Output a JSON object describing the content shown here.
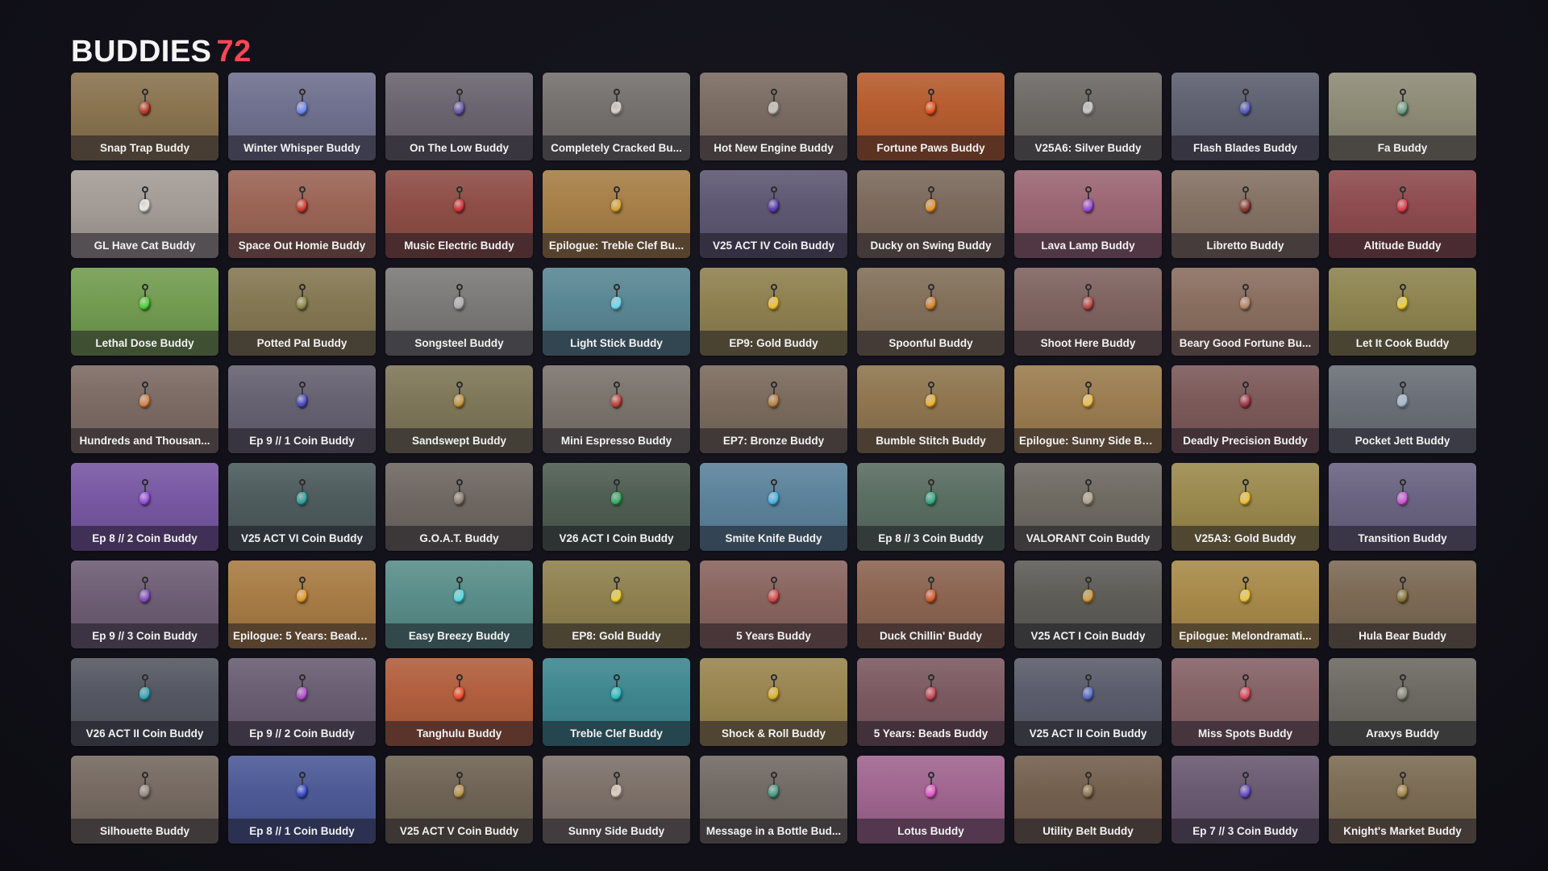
{
  "header": {
    "title": "BUDDIES",
    "count": "72"
  },
  "buddies": [
    {
      "name": "Snap Trap Buddy",
      "bg": "#8a7450",
      "charm": "#c0392b",
      "icon": "snap-trap-charm-icon"
    },
    {
      "name": "Winter Whisper Buddy",
      "bg": "#70718f",
      "charm": "#6e8cf0",
      "icon": "snowflake-charm-icon"
    },
    {
      "name": "On The Low Buddy",
      "bg": "#6a6570",
      "charm": "#6b5bb5",
      "icon": "on-the-low-charm-icon"
    },
    {
      "name": "Completely Cracked Bu...",
      "bg": "#75716e",
      "charm": "#d9d4cc",
      "icon": "cracked-egg-charm-icon"
    },
    {
      "name": "Hot New Engine Buddy",
      "bg": "#7b6c63",
      "charm": "#c8c2b8",
      "icon": "engine-charm-icon"
    },
    {
      "name": "Fortune Paws Buddy",
      "bg": "#b65d30",
      "charm": "#e8541c",
      "icon": "fortune-paws-charm-icon"
    },
    {
      "name": "V25A6: Silver Buddy",
      "bg": "#6d6a66",
      "charm": "#c9c9c9",
      "icon": "silver-emblem-charm-icon"
    },
    {
      "name": "Flash Blades Buddy",
      "bg": "#5f6070",
      "charm": "#5a5fc0",
      "icon": "flash-blades-charm-icon"
    },
    {
      "name": "Fa Buddy",
      "bg": "#8e8b77",
      "charm": "#6aa38c",
      "icon": "fa-charm-icon"
    },
    {
      "name": "GL Have Cat Buddy",
      "bg": "#a39c97",
      "charm": "#ece8e2",
      "icon": "cat-charm-icon"
    },
    {
      "name": "Space Out Homie Buddy",
      "bg": "#9b6556",
      "charm": "#d23a2e",
      "icon": "space-homie-charm-icon"
    },
    {
      "name": "Music Electric Buddy",
      "bg": "#8e4e47",
      "charm": "#d8343a",
      "icon": "guitar-charm-icon"
    },
    {
      "name": "Epilogue: Treble Clef Bu...",
      "bg": "#a77f47",
      "charm": "#d9a637",
      "icon": "treble-clef-charm-icon"
    },
    {
      "name": "V25 ACT IV Coin Buddy",
      "bg": "#5e5873",
      "charm": "#5d3fb8",
      "icon": "coin-charm-icon"
    },
    {
      "name": "Ducky on Swing Buddy",
      "bg": "#7c6a5d",
      "charm": "#f0962a",
      "icon": "duck-charm-icon"
    },
    {
      "name": "Lava Lamp Buddy",
      "bg": "#9c6775",
      "charm": "#9a4fd9",
      "icon": "lava-lamp-charm-icon"
    },
    {
      "name": "Libretto Buddy",
      "bg": "#847264",
      "charm": "#8f3b34",
      "icon": "libretto-charm-icon"
    },
    {
      "name": "Altitude Buddy",
      "bg": "#8e4c4f",
      "charm": "#e04450",
      "icon": "altitude-charm-icon"
    },
    {
      "name": "Lethal Dose Buddy",
      "bg": "#739c51",
      "charm": "#4cd13c",
      "icon": "lethal-dose-charm-icon"
    },
    {
      "name": "Potted Pal Buddy",
      "bg": "#857853",
      "charm": "#8f8a4d",
      "icon": "potted-plant-charm-icon"
    },
    {
      "name": "Songsteel Buddy",
      "bg": "#7b7a78",
      "charm": "#b0b0b5",
      "icon": "songsteel-charm-icon"
    },
    {
      "name": "Light Stick Buddy",
      "bg": "#5a8794",
      "charm": "#6fd9f0",
      "icon": "light-stick-charm-icon"
    },
    {
      "name": "EP9: Gold Buddy",
      "bg": "#8f8150",
      "charm": "#f2c12e",
      "icon": "gold-emblem-charm-icon"
    },
    {
      "name": "Spoonful Buddy",
      "bg": "#82705a",
      "charm": "#d9862e",
      "icon": "spoon-charm-icon"
    },
    {
      "name": "Shoot Here Buddy",
      "bg": "#7f6461",
      "charm": "#c24a4a",
      "icon": "target-charm-icon"
    },
    {
      "name": "Beary Good Fortune Bu...",
      "bg": "#8a6f60",
      "charm": "#b58a6a",
      "icon": "bear-charm-icon"
    },
    {
      "name": "Let It Cook Buddy",
      "bg": "#8d8450",
      "charm": "#f2d02e",
      "icon": "cooking-charm-icon"
    },
    {
      "name": "Hundreds and Thousan...",
      "bg": "#7d6b65",
      "charm": "#d9874a",
      "icon": "ice-cream-charm-icon"
    },
    {
      "name": "Ep 9 // 1 Coin Buddy",
      "bg": "#676272",
      "charm": "#4a4fc7",
      "icon": "coin-charm-icon"
    },
    {
      "name": "Sandswept Buddy",
      "bg": "#7f7759",
      "charm": "#c99a3e",
      "icon": "sandswept-charm-icon"
    },
    {
      "name": "Mini Espresso Buddy",
      "bg": "#7b746d",
      "charm": "#c8433b",
      "icon": "espresso-charm-icon"
    },
    {
      "name": "EP7: Bronze Buddy",
      "bg": "#7b6b5e",
      "charm": "#c08545",
      "icon": "bronze-emblem-charm-icon"
    },
    {
      "name": "Bumble Stitch Buddy",
      "bg": "#8f7650",
      "charm": "#f0b52a",
      "icon": "bee-charm-icon"
    },
    {
      "name": "Epilogue: Sunny Side Bu...",
      "bg": "#9b7d50",
      "charm": "#f0c24a",
      "icon": "sunny-side-charm-icon"
    },
    {
      "name": "Deadly Precision Buddy",
      "bg": "#7d5a5a",
      "charm": "#a63a45",
      "icon": "shuriken-charm-icon"
    },
    {
      "name": "Pocket Jett Buddy",
      "bg": "#6b7078",
      "charm": "#a7bcd1",
      "icon": "jett-charm-icon"
    },
    {
      "name": "Ep 8 // 2 Coin Buddy",
      "bg": "#7858a3",
      "charm": "#9b4fe0",
      "icon": "coin-charm-icon"
    },
    {
      "name": "V25 ACT VI Coin Buddy",
      "bg": "#4e5c5e",
      "charm": "#2fa8a0",
      "icon": "coin-charm-icon"
    },
    {
      "name": "G.O.A.T. Buddy",
      "bg": "#6f6863",
      "charm": "#8f8275",
      "icon": "goat-charm-icon"
    },
    {
      "name": "V26 ACT I Coin Buddy",
      "bg": "#4f5e52",
      "charm": "#38b56a",
      "icon": "coin-charm-icon"
    },
    {
      "name": "Smite Knife Buddy",
      "bg": "#5c839c",
      "charm": "#4ab8e8",
      "icon": "knife-charm-icon"
    },
    {
      "name": "Ep 8 // 3 Coin Buddy",
      "bg": "#5b6e62",
      "charm": "#2fb08a",
      "icon": "coin-charm-icon"
    },
    {
      "name": "VALORANT Coin Buddy",
      "bg": "#6f6b63",
      "charm": "#b3a98f",
      "icon": "valorant-coin-charm-icon"
    },
    {
      "name": "V25A3: Gold Buddy",
      "bg": "#9b8a4e",
      "charm": "#f2c12e",
      "icon": "gold-emblem-charm-icon"
    },
    {
      "name": "Transition Buddy",
      "bg": "#6a6482",
      "charm": "#d65adf",
      "icon": "transition-charm-icon"
    },
    {
      "name": "Ep 9 // 3 Coin Buddy",
      "bg": "#6f5e75",
      "charm": "#8a4fd0",
      "icon": "coin-charm-icon"
    },
    {
      "name": "Epilogue: 5 Years: Beads...",
      "bg": "#a87c45",
      "charm": "#e89a2a",
      "icon": "beads-charm-icon"
    },
    {
      "name": "Easy Breezy Buddy",
      "bg": "#5a8e8a",
      "charm": "#4ee0e8",
      "icon": "easy-breezy-charm-icon"
    },
    {
      "name": "EP8: Gold Buddy",
      "bg": "#8f8150",
      "charm": "#f2d02e",
      "icon": "gold-emblem-charm-icon"
    },
    {
      "name": "5 Years Buddy",
      "bg": "#8a6560",
      "charm": "#e04a4a",
      "icon": "five-years-charm-icon"
    },
    {
      "name": "Duck Chillin' Buddy",
      "bg": "#8c6552",
      "charm": "#e05a2a",
      "icon": "duck-chillin-charm-icon"
    },
    {
      "name": "V25 ACT I Coin Buddy",
      "bg": "#5e5d58",
      "charm": "#e0a03a",
      "icon": "coin-charm-icon"
    },
    {
      "name": "Epilogue: Melondramati...",
      "bg": "#a88a4a",
      "charm": "#f0c83a",
      "icon": "melon-charm-icon"
    },
    {
      "name": "Hula Bear Buddy",
      "bg": "#7c6a55",
      "charm": "#8a7a3a",
      "icon": "hula-bear-charm-icon"
    },
    {
      "name": "V26 ACT II Coin Buddy",
      "bg": "#555862",
      "charm": "#2fb0c0",
      "icon": "coin-charm-icon"
    },
    {
      "name": "Ep 9 // 2 Coin Buddy",
      "bg": "#6a5e72",
      "charm": "#b84fd0",
      "icon": "coin-charm-icon"
    },
    {
      "name": "Tanghulu Buddy",
      "bg": "#b15f3e",
      "charm": "#f04a2a",
      "icon": "tanghulu-charm-icon"
    },
    {
      "name": "Treble Clef Buddy",
      "bg": "#3f8790",
      "charm": "#2fc0c8",
      "icon": "treble-clef-charm-icon"
    },
    {
      "name": "Shock & Roll Buddy",
      "bg": "#998550",
      "charm": "#e0b52a",
      "icon": "shock-roll-charm-icon"
    },
    {
      "name": "5 Years: Beads Buddy",
      "bg": "#7c5a62",
      "charm": "#d04a5a",
      "icon": "beads-charm-icon"
    },
    {
      "name": "V25 ACT II Coin Buddy",
      "bg": "#5c5d6c",
      "charm": "#5a6fd0",
      "icon": "coin-charm-icon"
    },
    {
      "name": "Miss Spots Buddy",
      "bg": "#856367",
      "charm": "#e04a5a",
      "icon": "ladybug-charm-icon"
    },
    {
      "name": "Araxys Buddy",
      "bg": "#6c6a62",
      "charm": "#8f8f80",
      "icon": "araxys-charm-icon"
    },
    {
      "name": "Silhouette Buddy",
      "bg": "#766a62",
      "charm": "#9a8f85",
      "icon": "silhouette-charm-icon"
    },
    {
      "name": "Ep 8 // 1 Coin Buddy",
      "bg": "#4d5a96",
      "charm": "#3a4fd0",
      "icon": "coin-charm-icon"
    },
    {
      "name": "V25 ACT V Coin Buddy",
      "bg": "#6f6455",
      "charm": "#c09a4a",
      "icon": "coin-charm-icon"
    },
    {
      "name": "Sunny Side Buddy",
      "bg": "#7d716a",
      "charm": "#e0d0c0",
      "icon": "sunny-side-charm-icon"
    },
    {
      "name": "Message in a Bottle Bud...",
      "bg": "#726a65",
      "charm": "#4aa08a",
      "icon": "bottle-charm-icon"
    },
    {
      "name": "Lotus Buddy",
      "bg": "#a0668f",
      "charm": "#e85ad0",
      "icon": "lotus-charm-icon"
    },
    {
      "name": "Utility Belt Buddy",
      "bg": "#74604f",
      "charm": "#8f7a55",
      "icon": "utility-belt-charm-icon"
    },
    {
      "name": "Ep 7 // 3 Coin Buddy",
      "bg": "#6a5a72",
      "charm": "#6a4fd0",
      "icon": "coin-charm-icon"
    },
    {
      "name": "Knight's Market Buddy",
      "bg": "#7c6c55",
      "charm": "#a88a4a",
      "icon": "knight-charm-icon"
    }
  ]
}
